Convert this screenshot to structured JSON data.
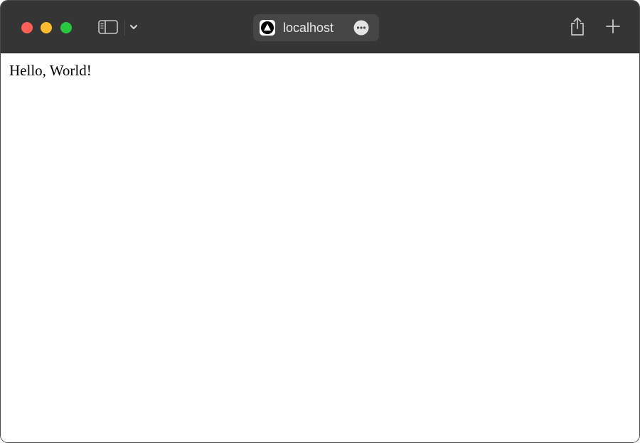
{
  "window": {
    "colors": {
      "toolbar_bg": "#353535",
      "close": "#fe5f57",
      "minimize": "#febc2e",
      "zoom": "#28c840"
    }
  },
  "toolbar": {
    "icons": {
      "close": "close-icon",
      "minimize": "minimize-icon",
      "zoom": "zoom-icon",
      "sidebar": "sidebar-icon",
      "chevron": "chevron-down-icon",
      "favicon": "triangle-logo-icon",
      "more": "more-icon",
      "share": "share-icon",
      "new_tab": "plus-icon"
    },
    "address": {
      "text": "localhost"
    }
  },
  "page": {
    "text": "Hello, World!"
  }
}
